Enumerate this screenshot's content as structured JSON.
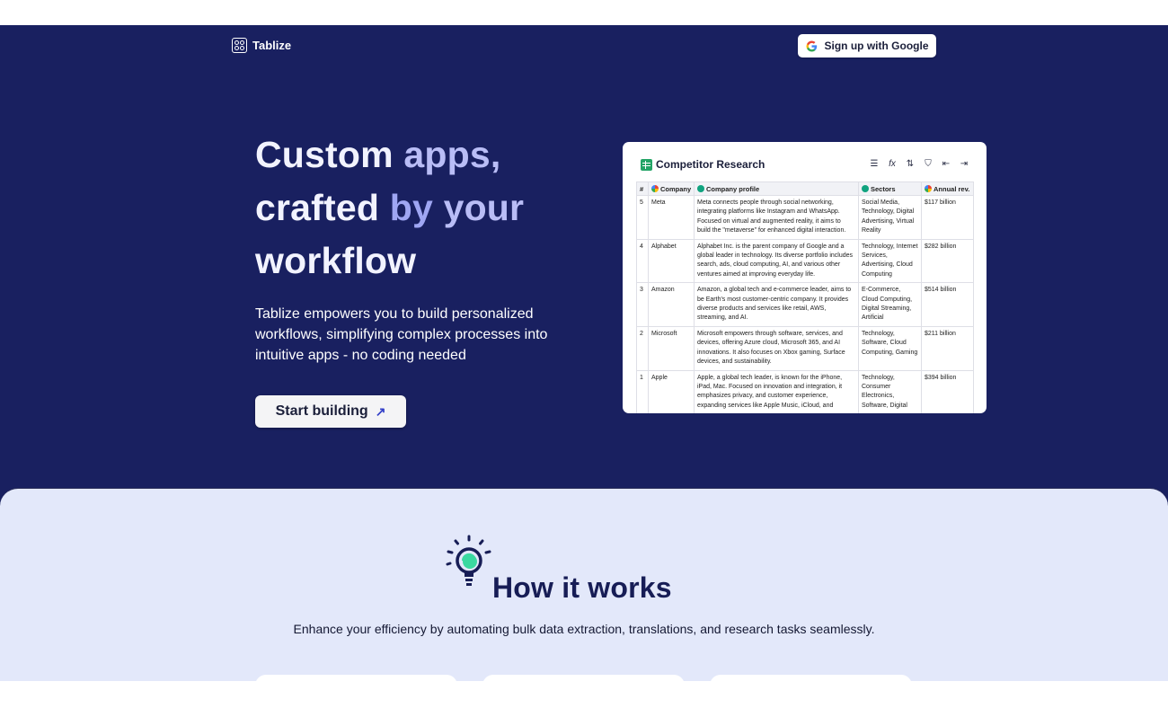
{
  "header": {
    "brand_name": "Tablize",
    "signup_label": "Sign up with Google"
  },
  "hero": {
    "headline": {
      "w1": "Custom",
      "w2": "apps,",
      "w3": "crafted",
      "w4": "by",
      "w5": "your",
      "w6": "workflow"
    },
    "subtext": "Tablize empowers you to build personalized workflows, simplifying complex processes into intuitive apps - no coding needed",
    "cta_label": "Start building",
    "cta_icon": "arrow-up-right-icon"
  },
  "preview": {
    "title": "Competitor Research",
    "toolbar_icons": [
      "menu-icon",
      "formula-icon",
      "sort-icon",
      "filter-icon",
      "import-icon",
      "export-icon"
    ],
    "columns": [
      "#",
      "Company",
      "Company profile",
      "Sectors",
      "Annual rev."
    ],
    "rows": [
      {
        "n": "5",
        "company": "Meta",
        "profile": "Meta connects people through social networking, integrating platforms like Instagram and WhatsApp. Focused on virtual and augmented reality, it aims to build the \"metaverse\" for enhanced digital interaction.",
        "sectors": "Social Media, Technology, Digital Advertising, Virtual Reality",
        "revenue": "$117 billion"
      },
      {
        "n": "4",
        "company": "Alphabet",
        "profile": "Alphabet Inc. is the parent company of Google and a global leader in technology. Its diverse portfolio includes search, ads, cloud computing, AI, and various other ventures aimed at improving everyday life.",
        "sectors": "Technology, Internet Services, Advertising, Cloud Computing",
        "revenue": "$282 billion"
      },
      {
        "n": "3",
        "company": "Amazon",
        "profile": "Amazon, a global tech and e-commerce leader, aims to be Earth's most customer-centric company. It provides diverse products and services like retail, AWS, streaming, and AI.",
        "sectors": "E-Commerce, Cloud Computing, Digital Streaming, Artificial",
        "revenue": "$514 billion"
      },
      {
        "n": "2",
        "company": "Microsoft",
        "profile": "Microsoft empowers through software, services, and devices, offering Azure cloud, Microsoft 365, and AI innovations. It also focuses on Xbox gaming, Surface devices, and sustainability.",
        "sectors": "Technology, Software, Cloud Computing, Gaming",
        "revenue": "$211 billion"
      },
      {
        "n": "1",
        "company": "Apple",
        "profile": "Apple, a global tech leader, is known for the iPhone, iPad, Mac. Focused on innovation and integration, it emphasizes privacy, and customer experience, expanding services like Apple Music, iCloud, and",
        "sectors": "Technology, Consumer Electronics, Software, Digital",
        "revenue": "$394 billion"
      }
    ]
  },
  "how_it_works": {
    "title": "How it works",
    "subtitle": "Enhance your efficiency by automating bulk data extraction, translations, and research tasks seamlessly.",
    "icon": "lightbulb-icon"
  },
  "colors": {
    "hero_bg": "#192060",
    "accent_light": "#b9bdf6",
    "section_bg": "#e3e8fa",
    "title_navy": "#171d56"
  }
}
